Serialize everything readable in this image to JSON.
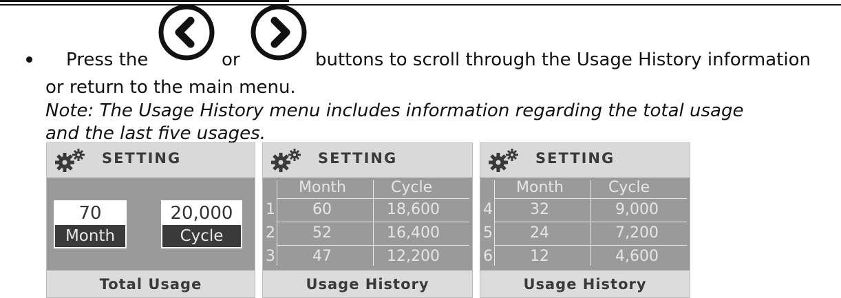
{
  "instruction": {
    "press_the": "Press the",
    "or": "or",
    "after_buttons": "buttons to scroll through the Usage History information",
    "line2": "or return to the main menu.",
    "note_line1": "Note: The Usage History menu includes information regarding the total usage",
    "note_line2": "and the last five usages."
  },
  "icons": {
    "prev": "chevron-left-circle",
    "next": "chevron-right-circle",
    "setting": "gears"
  },
  "panels": [
    {
      "header": "SETTING",
      "footer": "Total Usage",
      "month_value": "70",
      "month_label": "Month",
      "cycle_value": "20,000",
      "cycle_label": "Cycle"
    },
    {
      "header": "SETTING",
      "footer": "Usage History",
      "col_month": "Month",
      "col_cycle": "Cycle",
      "rows": [
        {
          "idx": "1",
          "month": "60",
          "cycle": "18,600"
        },
        {
          "idx": "2",
          "month": "52",
          "cycle": "16,400"
        },
        {
          "idx": "3",
          "month": "47",
          "cycle": "12,200"
        }
      ]
    },
    {
      "header": "SETTING",
      "footer": "Usage History",
      "col_month": "Month",
      "col_cycle": "Cycle",
      "rows": [
        {
          "idx": "4",
          "month": "32",
          "cycle": "9,000"
        },
        {
          "idx": "5",
          "month": "24",
          "cycle": "7,200"
        },
        {
          "idx": "6",
          "month": "12",
          "cycle": "4,600"
        }
      ]
    }
  ]
}
